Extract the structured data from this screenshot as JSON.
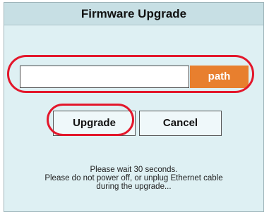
{
  "dialog": {
    "title": "Firmware Upgrade",
    "path_input": {
      "value": "",
      "placeholder": ""
    },
    "path_button_label": "path",
    "upgrade_label": "Upgrade",
    "cancel_label": "Cancel",
    "notice_lines": [
      "Please wait 30 seconds.",
      "Please do not power off, or unplug Ethernet cable",
      "during the upgrade..."
    ]
  },
  "annotations": {
    "highlight_color": "#e3172b"
  },
  "colors": {
    "dialog_background": "#def0f3",
    "header_background": "#c7dfe4",
    "path_button": "#e87f2e"
  }
}
